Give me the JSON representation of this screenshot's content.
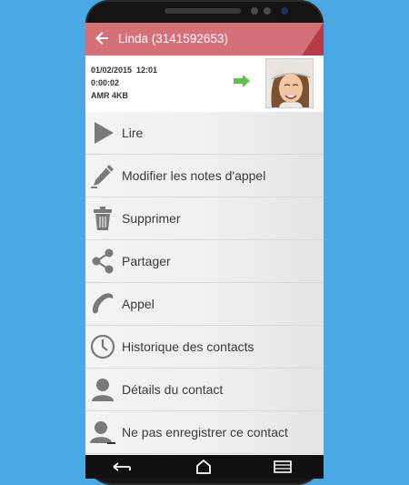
{
  "colors": {
    "page_background": "#4aa8e4",
    "appbar": "#d57079",
    "appbar_corner": "#b73a49",
    "direction_arrow": "#5cc24a",
    "icon_gray": "#7a7a7a"
  },
  "appbar": {
    "title": "Linda (3141592653)",
    "back_icon": "arrow-left-icon"
  },
  "recording": {
    "datetime": "01/02/2015  12:01",
    "duration": "0:00:02",
    "format": "AMR 4KB",
    "direction_icon": "arrow-right-icon",
    "contact_photo": "contact-photo"
  },
  "menu": {
    "items": [
      {
        "label": "Lire",
        "icon": "play-icon"
      },
      {
        "label": "Modifier les notes d'appel",
        "icon": "pencil-icon"
      },
      {
        "label": "Supprimer",
        "icon": "trash-icon"
      },
      {
        "label": "Partager",
        "icon": "share-icon"
      },
      {
        "label": "Appel",
        "icon": "phone-icon"
      },
      {
        "label": "Historique des contacts",
        "icon": "clock-icon"
      },
      {
        "label": "Détails du contact",
        "icon": "person-icon"
      },
      {
        "label": "Ne pas enregistrer ce contact",
        "icon": "person-minus-icon"
      }
    ]
  },
  "navbar": {
    "back_icon": "nav-back-icon",
    "home_icon": "home-icon",
    "recents_icon": "recents-icon"
  }
}
